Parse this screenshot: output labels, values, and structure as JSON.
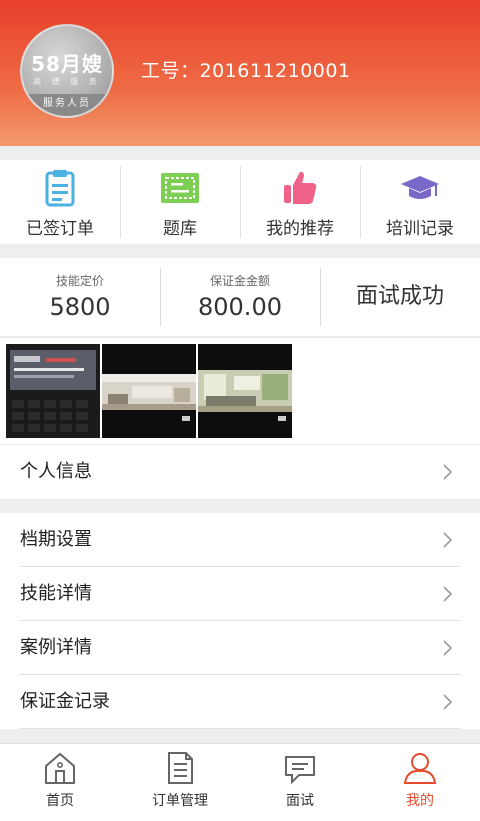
{
  "header": {
    "avatar_brand": "58月嫂",
    "avatar_tag": "高 德 服 务",
    "avatar_ribbon": "服务人员",
    "work_number": "工号：201611210001"
  },
  "quick_actions": [
    {
      "label": "已签订单",
      "icon": "clipboard-icon",
      "color": "#4bb0e2"
    },
    {
      "label": "题库",
      "icon": "ticket-icon",
      "color": "#7ccf52"
    },
    {
      "label": "我的推荐",
      "icon": "thumbs-up-icon",
      "color": "#f0628a"
    },
    {
      "label": "培训记录",
      "icon": "graduation-cap-icon",
      "color": "#7a68c9"
    }
  ],
  "stats": {
    "skill_price_label": "技能定价",
    "skill_price_value": "5800",
    "deposit_label": "保证金金额",
    "deposit_value": "800.00",
    "interview_status": "面试成功"
  },
  "photos": [
    "phone-screenshot-photo",
    "living-room-photo-1",
    "living-room-photo-2"
  ],
  "menu": [
    {
      "label": "个人信息"
    },
    {
      "label": "档期设置"
    },
    {
      "label": "技能详情"
    },
    {
      "label": "案例详情"
    },
    {
      "label": "保证金记录"
    }
  ],
  "tabbar": {
    "items": [
      {
        "label": "首页",
        "icon": "home-icon"
      },
      {
        "label": "订单管理",
        "icon": "document-icon"
      },
      {
        "label": "面试",
        "icon": "chat-icon"
      },
      {
        "label": "我的",
        "icon": "user-icon"
      }
    ],
    "active_color": "#e64a2e"
  }
}
